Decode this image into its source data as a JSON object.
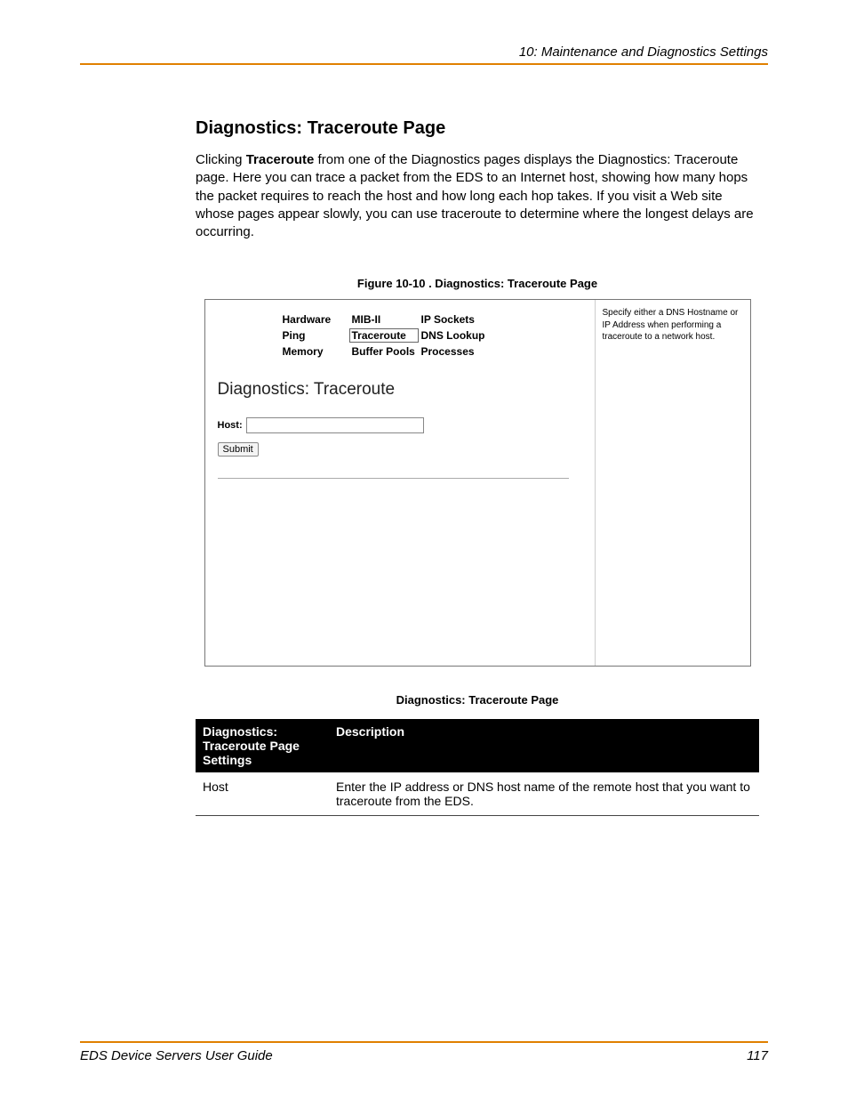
{
  "header": {
    "chapter": "10: Maintenance and Diagnostics Settings"
  },
  "section": {
    "title": "Diagnostics: Traceroute Page",
    "para_pre": "Clicking ",
    "para_bold": "Traceroute",
    "para_post": " from one of the Diagnostics pages displays the Diagnostics: Traceroute page. Here you can trace a packet from the EDS to an Internet host, showing how many hops the packet requires to reach the host and how long each hop takes. If you visit a Web site whose pages appear slowly, you can use traceroute to determine where the longest delays are occurring."
  },
  "figure": {
    "caption": "Figure 10-10 . Diagnostics: Traceroute Page",
    "nav": {
      "row1": [
        "Hardware",
        "MIB-II",
        "IP Sockets"
      ],
      "row2": [
        "Ping",
        "Traceroute",
        "DNS Lookup"
      ],
      "row3": [
        "Memory",
        "Buffer Pools",
        "Processes"
      ]
    },
    "panel_title": "Diagnostics: Traceroute",
    "host_label": "Host:",
    "submit_label": "Submit",
    "help_text": "Specify either a DNS Hostname or IP Address when performing a traceroute to a network host."
  },
  "table": {
    "caption": "Diagnostics: Traceroute Page",
    "headers": [
      "Diagnostics: Traceroute Page Settings",
      "Description"
    ],
    "rows": [
      {
        "setting": "Host",
        "desc": "Enter the IP address or DNS host name of the remote host that you want to traceroute from the EDS."
      }
    ]
  },
  "footer": {
    "left": "EDS Device Servers User Guide",
    "right": "117"
  }
}
